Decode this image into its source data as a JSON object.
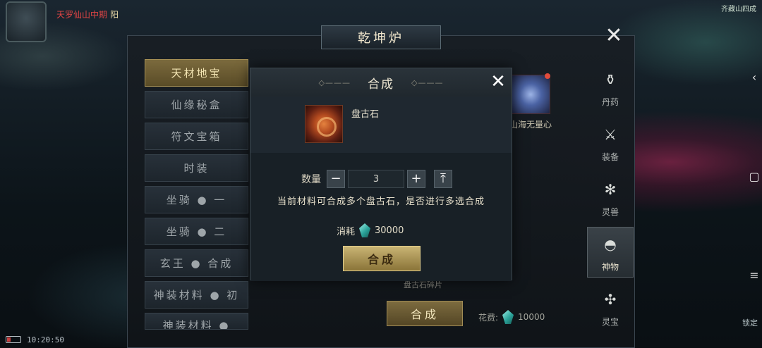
{
  "hud": {
    "top_title": "天罗仙山中期",
    "top_title_tail": "阳",
    "time": "10:20:50",
    "lock_label": "锁定",
    "right_top": "齐藏山四成"
  },
  "panel": {
    "title": "乾坤炉",
    "categories": [
      {
        "label": "天材地宝",
        "active": true
      },
      {
        "label": "仙缘秘盒"
      },
      {
        "label": "符文宝箱"
      },
      {
        "label": "时装"
      },
      {
        "label": "坐骑 ● 一"
      },
      {
        "label": "坐骑 ● 二"
      },
      {
        "label": "玄王 ● 合成"
      },
      {
        "label": "神装材料 ● 初"
      },
      {
        "label": "神装材料 ●"
      }
    ],
    "side_tabs": [
      {
        "label": "丹药",
        "icon": "mortar-icon"
      },
      {
        "label": "装备",
        "icon": "sword-icon"
      },
      {
        "label": "灵兽",
        "icon": "paw-icon"
      },
      {
        "label": "神物",
        "icon": "fan-icon",
        "active": true
      },
      {
        "label": "灵宝",
        "icon": "swirl-icon"
      }
    ],
    "bg_item_label": "山海无量心",
    "bg_shard_label": "盘古石碎片",
    "bg_synth_label": "合成",
    "bg_cost_label": "花费:",
    "bg_cost_value": "10000"
  },
  "modal": {
    "title": "合成",
    "item_name": "盘古石",
    "qty_label": "数量",
    "qty_value": "3",
    "qty_minus": "−",
    "qty_plus": "+",
    "qty_max": "⤒",
    "prompt": "当前材料可合成多个盘古石，是否进行多选合成",
    "cost_label": "消耗",
    "cost_value": "30000",
    "button_label": "合成"
  },
  "colors": {
    "accent_gold": "#c9b474",
    "active_tab": "#7b6a3d",
    "currency_gem": "#2ba39a"
  }
}
